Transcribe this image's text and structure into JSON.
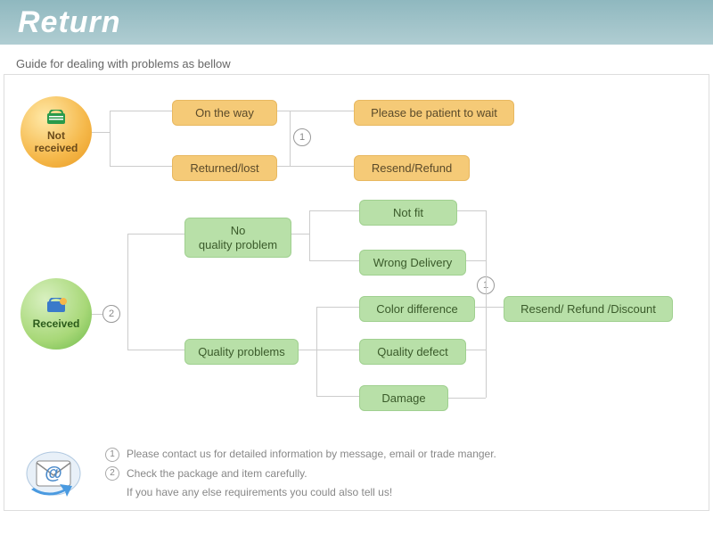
{
  "header": {
    "title": "Return"
  },
  "guide": "Guide for dealing with problems as bellow",
  "badges": {
    "not_received": {
      "line1": "Not",
      "line2": "received"
    },
    "received": "Received"
  },
  "flow": {
    "on_the_way": "On the way",
    "returned_lost": "Returned/lost",
    "please_wait": "Please be patient to wait",
    "resend_refund": "Resend/Refund",
    "no_quality": "No",
    "no_quality2": "quality problem",
    "quality_problems": "Quality problems",
    "not_fit": "Not fit",
    "wrong_delivery": "Wrong Delivery",
    "color_diff": "Color difference",
    "quality_defect": "Quality defect",
    "damage": "Damage",
    "final": "Resend/ Refund /Discount"
  },
  "notes": {
    "n1": "1",
    "n2": "2",
    "line1": "Please contact us for detailed information by message, email or trade manger.",
    "line2": "Check the package and item carefully.",
    "line3": "If you have any else requirements you could also tell us!"
  }
}
